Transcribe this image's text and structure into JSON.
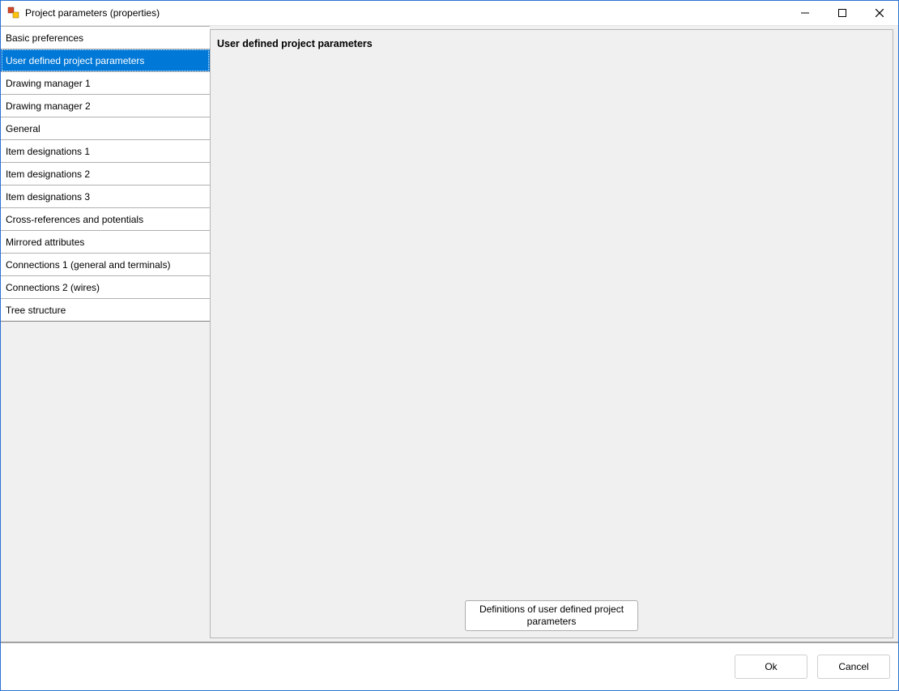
{
  "window": {
    "title": "Project parameters (properties)"
  },
  "sidebar": {
    "items": [
      {
        "label": "Basic preferences",
        "selected": false
      },
      {
        "label": "User defined project parameters",
        "selected": true
      },
      {
        "label": "Drawing manager 1",
        "selected": false
      },
      {
        "label": "Drawing manager 2",
        "selected": false
      },
      {
        "label": "General",
        "selected": false
      },
      {
        "label": "Item designations 1",
        "selected": false
      },
      {
        "label": "Item designations 2",
        "selected": false
      },
      {
        "label": "Item designations 3",
        "selected": false
      },
      {
        "label": "Cross-references and potentials",
        "selected": false
      },
      {
        "label": "Mirrored attributes",
        "selected": false
      },
      {
        "label": "Connections 1 (general and terminals)",
        "selected": false
      },
      {
        "label": "Connections 2 (wires)",
        "selected": false
      },
      {
        "label": "Tree structure",
        "selected": false
      }
    ]
  },
  "content": {
    "title": "User defined project parameters",
    "definitions_button": "Definitions of user defined project parameters"
  },
  "footer": {
    "ok": "Ok",
    "cancel": "Cancel"
  }
}
